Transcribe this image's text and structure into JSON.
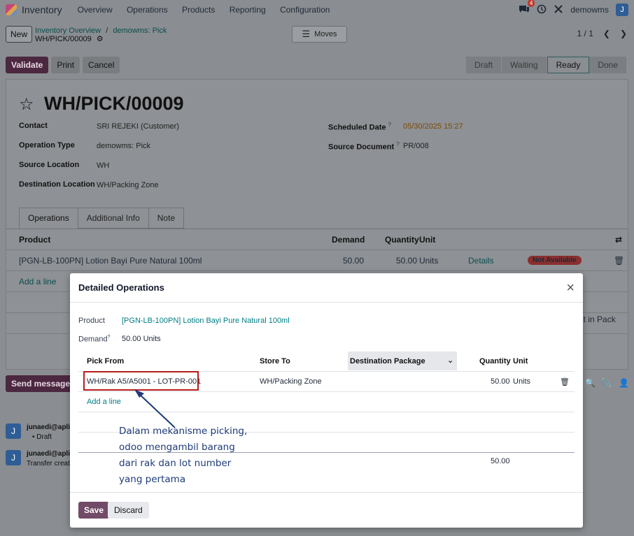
{
  "navbar": {
    "app_name": "Inventory",
    "menu": [
      "Overview",
      "Operations",
      "Products",
      "Reporting",
      "Configuration"
    ],
    "notification_count": "4",
    "company": "demowms",
    "user_initial": "J"
  },
  "control_panel": {
    "new_label": "New",
    "breadcrumb_parent": "Inventory Overview",
    "breadcrumb_sep": "/",
    "breadcrumb_mid": "demowms: Pick",
    "breadcrumb_current": "WH/PICK/00009",
    "moves_label": "Moves",
    "pager": "1 / 1"
  },
  "actions": {
    "validate": "Validate",
    "print": "Print",
    "cancel": "Cancel"
  },
  "statusbar": [
    "Draft",
    "Waiting",
    "Ready",
    "Done"
  ],
  "statusbar_active": "Ready",
  "record": {
    "title": "WH/PICK/00009",
    "contact_label": "Contact",
    "contact": "SRI REJEKI (Customer)",
    "op_type_label": "Operation Type",
    "op_type": "demowms: Pick",
    "src_loc_label": "Source Location",
    "src_loc": "WH",
    "dest_loc_label": "Destination Location",
    "dest_loc": "WH/Packing Zone",
    "sched_label": "Scheduled Date",
    "sched": "05/30/2025 15:27",
    "src_doc_label": "Source Document",
    "src_doc": "PR/008",
    "help_mark": "?"
  },
  "tabs": [
    "Operations",
    "Additional Info",
    "Note"
  ],
  "operations_table": {
    "headers": {
      "product": "Product",
      "demand": "Demand",
      "quantity": "Quantity",
      "unit": "Unit"
    },
    "row": {
      "product": "[PGN-LB-100PN] Lotion Bayi Pure Natural 100ml",
      "demand": "50.00",
      "quantity": "50.00",
      "unit": "Units",
      "details": "Details",
      "availability": "Not Available"
    },
    "add_line": "Add a line",
    "put_in_pack": "ut in Pack"
  },
  "chatter": {
    "send_message": "Send message",
    "msg1_author": "junaedi@aplika",
    "msg1_text": "Draft",
    "msg2_author": "junaedi@aplika",
    "msg2_text": "Transfer creat",
    "avatar": "J"
  },
  "modal": {
    "title": "Detailed Operations",
    "product_label": "Product",
    "product_value": "[PGN-LB-100PN] Lotion Bayi Pure Natural 100ml",
    "demand_label": "Demand",
    "demand_value": "50.00 Units",
    "columns": {
      "pick_from": "Pick From",
      "store_to": "Store To",
      "dest_package": "Destination Package",
      "quantity": "Quantity",
      "unit": "Unit"
    },
    "line": {
      "pick_from": "WH/Rak A5/A5001 - LOT-PR-001",
      "store_to": "WH/Packing Zone",
      "quantity": "50.00",
      "unit": "Units"
    },
    "add_line": "Add a line",
    "total": "50.00",
    "save": "Save",
    "discard": "Discard"
  },
  "annotation": {
    "line1": "Dalam mekanisme picking,",
    "line2": "odoo mengambil barang",
    "line3": "dari rak dan lot number",
    "line4": "yang pertama"
  }
}
